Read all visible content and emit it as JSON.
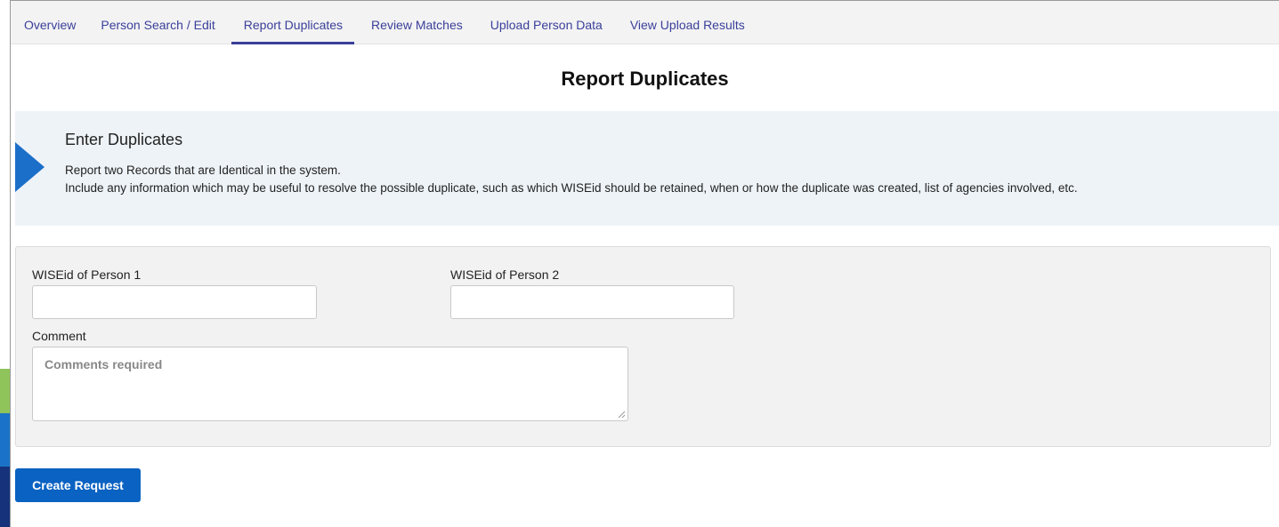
{
  "tabs": [
    {
      "label": "Overview"
    },
    {
      "label": "Person Search / Edit"
    },
    {
      "label": "Report Duplicates",
      "active": true
    },
    {
      "label": "Review Matches"
    },
    {
      "label": "Upload Person Data"
    },
    {
      "label": "View Upload Results"
    }
  ],
  "page": {
    "title": "Report Duplicates"
  },
  "info": {
    "title": "Enter Duplicates",
    "line1": "Report two Records that are Identical in the system.",
    "line2": "Include any information which may be useful to resolve the possible duplicate, such as which WISEid should be retained, when or how the duplicate was created, list of agencies involved, etc."
  },
  "form": {
    "person1_label": "WISEid of Person 1",
    "person1_value": "",
    "person2_label": "WISEid of Person 2",
    "person2_value": "",
    "comment_label": "Comment",
    "comment_placeholder": "Comments required"
  },
  "actions": {
    "create_label": "Create Request"
  },
  "colors": {
    "accent": "#3a3f9a",
    "button": "#0a62c2",
    "arrow": "#1b6fc9",
    "info_bg": "#eef3f7",
    "form_bg": "#f2f2f2"
  }
}
